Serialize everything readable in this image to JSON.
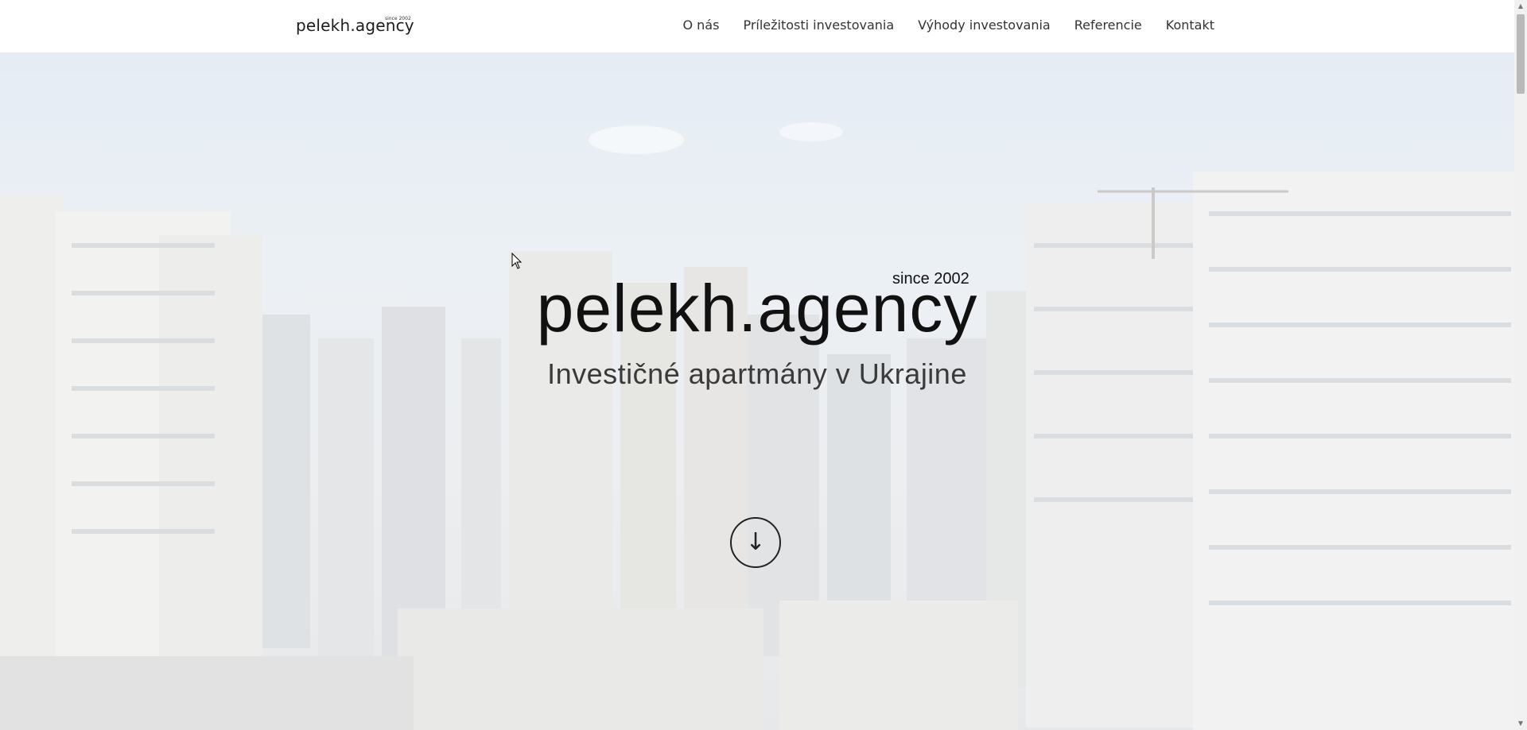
{
  "header": {
    "logo": "pelekh.agency",
    "logo_since": "since 2002",
    "nav": [
      {
        "label": "O nás"
      },
      {
        "label": "Príležitosti investovania"
      },
      {
        "label": "Výhody investovania"
      },
      {
        "label": "Referencie"
      },
      {
        "label": "Kontakt"
      }
    ]
  },
  "hero": {
    "since": "since 2002",
    "title": "pelekh.agency",
    "subtitle": "Investičné apartmány v Ukrajine",
    "scroll_icon": "arrow-down-icon"
  },
  "colors": {
    "text_dark": "#111111",
    "overlay": "#ffffff"
  }
}
